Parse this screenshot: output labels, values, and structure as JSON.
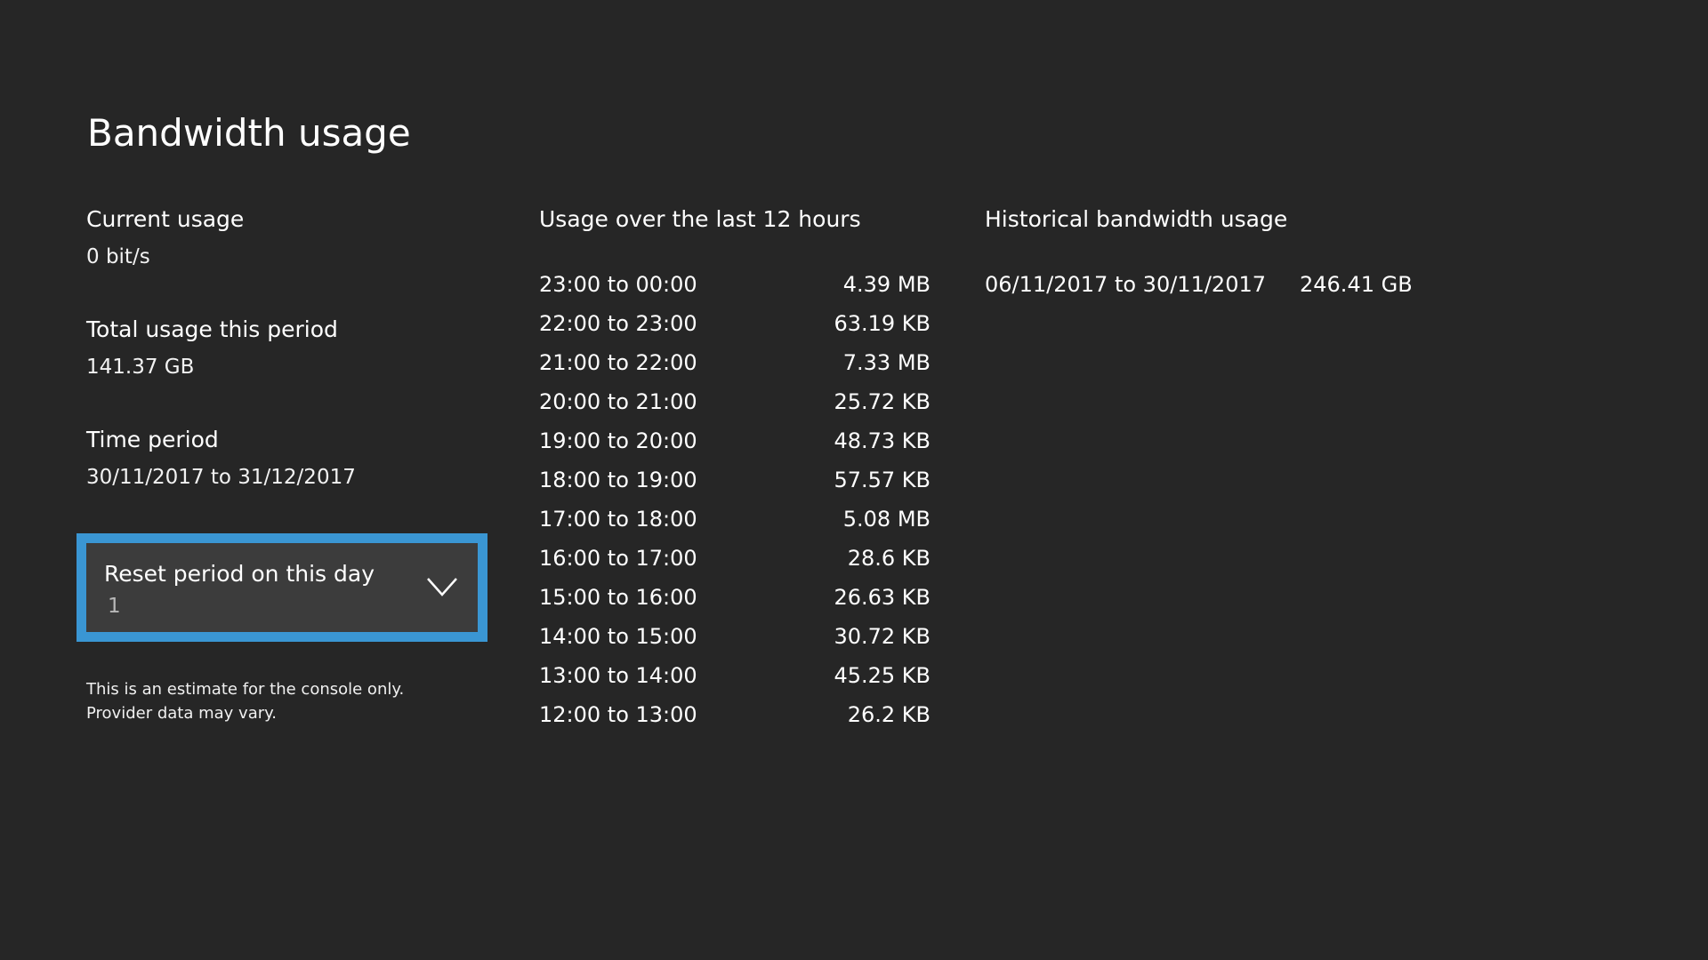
{
  "page": {
    "title": "Bandwidth usage"
  },
  "left": {
    "current_usage": {
      "label": "Current usage",
      "value": "0 bit/s"
    },
    "total_usage": {
      "label": "Total usage this period",
      "value": "141.37 GB"
    },
    "time_period": {
      "label": "Time period",
      "value": "30/11/2017 to 31/12/2017"
    },
    "reset_select": {
      "label": "Reset period on this day",
      "value": "1",
      "icon": "chevron-down-icon"
    },
    "footnote": {
      "line1": "This is an estimate for the console only.",
      "line2": "Provider data may vary."
    }
  },
  "usage": {
    "heading": "Usage over the last 12 hours",
    "rows": [
      {
        "range": "23:00 to 00:00",
        "amount": "4.39 MB"
      },
      {
        "range": "22:00 to 23:00",
        "amount": "63.19 KB"
      },
      {
        "range": "21:00 to 22:00",
        "amount": "7.33 MB"
      },
      {
        "range": "20:00 to 21:00",
        "amount": "25.72 KB"
      },
      {
        "range": "19:00 to 20:00",
        "amount": "48.73 KB"
      },
      {
        "range": "18:00 to 19:00",
        "amount": "57.57 KB"
      },
      {
        "range": "17:00 to 18:00",
        "amount": "5.08 MB"
      },
      {
        "range": "16:00 to 17:00",
        "amount": "28.6 KB"
      },
      {
        "range": "15:00 to 16:00",
        "amount": "26.63 KB"
      },
      {
        "range": "14:00 to 15:00",
        "amount": "30.72 KB"
      },
      {
        "range": "13:00 to 14:00",
        "amount": "45.25 KB"
      },
      {
        "range": "12:00 to 13:00",
        "amount": "26.2 KB"
      }
    ]
  },
  "historical": {
    "heading": "Historical bandwidth usage",
    "rows": [
      {
        "range": "06/11/2017 to 30/11/2017",
        "amount": "246.41 GB"
      }
    ]
  },
  "colors": {
    "background": "#262626",
    "accent": "#3a96d3",
    "select_fill": "#3c3c3c"
  }
}
